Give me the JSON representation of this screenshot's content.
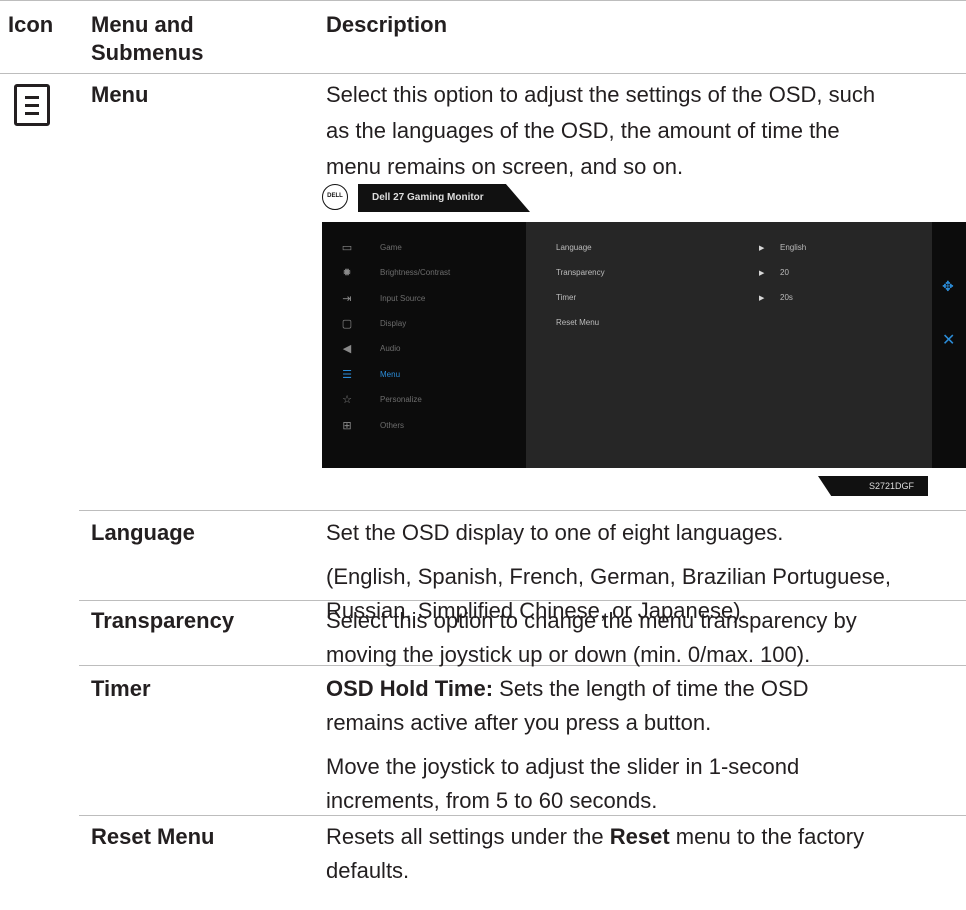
{
  "table": {
    "headers": {
      "icon": "Icon",
      "menu_line1": "Menu and",
      "menu_line2": "Submenus",
      "description": "Description"
    },
    "rows": {
      "menu": {
        "label": "Menu",
        "desc_lines": [
          "Select this option to adjust the settings of the OSD, such",
          "as the languages of the OSD, the amount of time the",
          "menu remains on screen, and so on."
        ]
      },
      "language": {
        "label": "Language",
        "desc_lines": [
          "Set the OSD display to one of eight languages.",
          "(English, Spanish, French, German, Brazilian Portuguese,",
          "Russian, Simplified Chinese, or Japanese)."
        ]
      },
      "transparency": {
        "label": "Transparency",
        "desc_lines": [
          "Select this option to change the menu transparency by",
          "moving the joystick up or down (min. 0/max. 100)."
        ]
      },
      "timer": {
        "label": "Timer",
        "bold_prefix": "OSD Hold Time:",
        "desc_line1_rest": " Sets the length of time the OSD",
        "desc_lines": [
          "remains active after you press a button.",
          "Move the joystick to adjust the slider in 1-second",
          "increments, from 5 to 60 seconds."
        ]
      },
      "reset": {
        "label": "Reset Menu",
        "desc_pre": "Resets all settings under the ",
        "desc_bold": "Reset",
        "desc_post": " menu to the factory",
        "desc_line2": "defaults."
      }
    }
  },
  "osd": {
    "logo": "DELL",
    "title": "Dell 27 Gaming Monitor",
    "model": "S2721DGF",
    "menu_items": [
      "Game",
      "Brightness/Contrast",
      "Input Source",
      "Display",
      "Audio",
      "Menu",
      "Personalize",
      "Others"
    ],
    "menu_icons": [
      "game-icon",
      "brightness-icon",
      "input-source-icon",
      "display-icon",
      "audio-icon",
      "menu-icon",
      "star-icon",
      "others-icon"
    ],
    "active_item": "Menu",
    "settings": [
      {
        "name": "Language",
        "value": "English"
      },
      {
        "name": "Transparency",
        "value": "20"
      },
      {
        "name": "Timer",
        "value": "20s"
      },
      {
        "name": "Reset Menu",
        "value": ""
      }
    ],
    "accent_color": "#2b8cd8"
  }
}
